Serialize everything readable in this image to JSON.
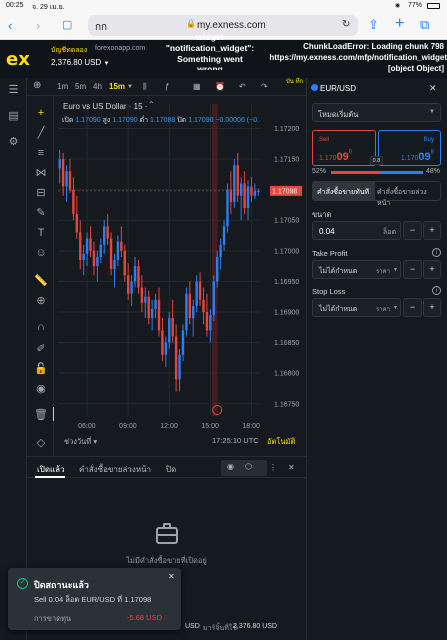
{
  "status": {
    "time": "00:25",
    "date": "จ. 29 เม.ย.",
    "battery": "77%"
  },
  "browser": {
    "aa_label": "กก",
    "url": "my.exness.com"
  },
  "header": {
    "account_tag": "บัญชีทดลอง",
    "site": "forexonapp.com",
    "balance": "2,376.80 USD",
    "error_widget_line1": "widget",
    "error_widget_line2": "\"notification_widget\":",
    "error_widget_line3": "Something went",
    "error_widget_line4": "wrong",
    "error_chunk_line1": "ChunkLoadError: Loading chunk 798",
    "error_chunk_line2": "https://my.exness.com/mfp/notification_widget",
    "error_chunk_line3": "[object Object]"
  },
  "chart_toolbar": {
    "tf1": "1m",
    "tf2": "5m",
    "tf3": "4h",
    "tf4": "15m",
    "extra": "บัน\nทึก"
  },
  "chart": {
    "title": "Euro vs US Dollar · 15 ·",
    "o_label": "เปิด",
    "o_val": "1.17090",
    "h_label": "สูง",
    "h_val": "1.17090",
    "l_label": "ต่ำ",
    "l_val": "1.17088",
    "c_label": "ปิด",
    "c_val": "1.17090",
    "change": "−0.00006 (−0.",
    "current_price": "1.17098",
    "range_label": "ช่วงวันที่",
    "clock": "17:25:10 UTC",
    "auto_label": "อัตโนมัติ"
  },
  "chart_data": {
    "type": "candlestick",
    "ylim": [
      1.1673,
      1.1724
    ],
    "yticks": [
      1.172,
      1.1715,
      1.171,
      1.1705,
      1.17,
      1.1695,
      1.169,
      1.1685,
      1.168,
      1.1675
    ],
    "ytick_labels": [
      "1.17200",
      "1.17150",
      "1.17100",
      "1.17050",
      "1.17000",
      "1.16950",
      "1.16900",
      "1.16850",
      "1.16800",
      "1.16750"
    ],
    "xtick_labels": [
      "06:00",
      "09:00",
      "12:00",
      "15:00",
      "18:00"
    ],
    "xtick_bars": [
      8,
      20,
      32,
      44,
      56
    ],
    "bar_count": 59,
    "candles": [
      [
        1.17135,
        1.17165,
        1.1711,
        1.1715
      ],
      [
        1.1715,
        1.1716,
        1.1709,
        1.17105
      ],
      [
        1.17105,
        1.1714,
        1.1708,
        1.1713
      ],
      [
        1.1713,
        1.1715,
        1.17095,
        1.171
      ],
      [
        1.171,
        1.1712,
        1.1705,
        1.1706
      ],
      [
        1.1706,
        1.1709,
        1.1702,
        1.1703
      ],
      [
        1.1703,
        1.1705,
        1.1697,
        1.16985
      ],
      [
        1.16985,
        1.1701,
        1.1696,
        1.16995
      ],
      [
        1.16995,
        1.1703,
        1.16975,
        1.1702
      ],
      [
        1.1702,
        1.1704,
        1.1699,
        1.17
      ],
      [
        1.17,
        1.17015,
        1.1696,
        1.16975
      ],
      [
        1.16975,
        1.17,
        1.1695,
        1.1699
      ],
      [
        1.1699,
        1.1702,
        1.1698,
        1.1701
      ],
      [
        1.1701,
        1.1705,
        1.16995,
        1.1704
      ],
      [
        1.1704,
        1.1706,
        1.1701,
        1.1702
      ],
      [
        1.1702,
        1.1703,
        1.1696,
        1.1697
      ],
      [
        1.1697,
        1.16995,
        1.1694,
        1.16985
      ],
      [
        1.16985,
        1.17025,
        1.16975,
        1.17015
      ],
      [
        1.17015,
        1.1704,
        1.1699,
        1.17
      ],
      [
        1.17,
        1.1701,
        1.1695,
        1.1696
      ],
      [
        1.1696,
        1.1698,
        1.1692,
        1.1693
      ],
      [
        1.1693,
        1.1696,
        1.1691,
        1.1695
      ],
      [
        1.1695,
        1.1699,
        1.1694,
        1.16975
      ],
      [
        1.16975,
        1.16985,
        1.1693,
        1.1694
      ],
      [
        1.1694,
        1.1696,
        1.169,
        1.16915
      ],
      [
        1.16915,
        1.1694,
        1.1689,
        1.16925
      ],
      [
        1.16925,
        1.16935,
        1.1688,
        1.1689
      ],
      [
        1.1689,
        1.1692,
        1.1687,
        1.16905
      ],
      [
        1.16905,
        1.1693,
        1.1689,
        1.1692
      ],
      [
        1.1692,
        1.1694,
        1.1686,
        1.1687
      ],
      [
        1.1687,
        1.1689,
        1.1682,
        1.1683
      ],
      [
        1.1683,
        1.1686,
        1.1681,
        1.1685
      ],
      [
        1.1685,
        1.169,
        1.1684,
        1.1689
      ],
      [
        1.1689,
        1.1692,
        1.1685,
        1.1686
      ],
      [
        1.1686,
        1.1688,
        1.1677,
        1.1679
      ],
      [
        1.1679,
        1.1684,
        1.1677,
        1.1683
      ],
      [
        1.1683,
        1.1688,
        1.1682,
        1.1687
      ],
      [
        1.1687,
        1.1694,
        1.1686,
        1.1693
      ],
      [
        1.1693,
        1.1695,
        1.1688,
        1.1689
      ],
      [
        1.1689,
        1.1692,
        1.1686,
        1.1691
      ],
      [
        1.1691,
        1.1696,
        1.169,
        1.1695
      ],
      [
        1.1695,
        1.16965,
        1.1691,
        1.1692
      ],
      [
        1.1692,
        1.1694,
        1.1688,
        1.169
      ],
      [
        1.169,
        1.1693,
        1.1686,
        1.1687
      ],
      [
        1.1687,
        1.16905,
        1.1685,
        1.16895
      ],
      [
        1.16895,
        1.1696,
        1.16885,
        1.1695
      ],
      [
        1.1695,
        1.17,
        1.1694,
        1.1699
      ],
      [
        1.1699,
        1.1702,
        1.1697,
        1.1701
      ],
      [
        1.1701,
        1.1705,
        1.17,
        1.1704
      ],
      [
        1.1704,
        1.1711,
        1.1703,
        1.171
      ],
      [
        1.171,
        1.1713,
        1.1706,
        1.1708
      ],
      [
        1.1708,
        1.1715,
        1.1707,
        1.1714
      ],
      [
        1.1714,
        1.1716,
        1.1708,
        1.1709
      ],
      [
        1.1709,
        1.1712,
        1.1705,
        1.1711
      ],
      [
        1.1711,
        1.1713,
        1.1706,
        1.1707
      ],
      [
        1.1707,
        1.17115,
        1.1705,
        1.17105
      ],
      [
        1.17105,
        1.1712,
        1.1708,
        1.1709
      ],
      [
        1.1709,
        1.1711,
        1.17085,
        1.17098
      ],
      [
        1.17098,
        1.17102,
        1.1709,
        1.17098
      ]
    ]
  },
  "bottom": {
    "tab_open": "เปิดแล้ว",
    "tab_pending": "คำสั่งซื้อขายล่วงหน้า",
    "tab_closed": "ปิด",
    "empty_text": "ไม่มีคำสั่งซื้อขายที่เปิดอยู่",
    "foot_currency": "USD",
    "foot_margin_label": "มาร์จิ้นที่ใช้",
    "foot_balance": "2,376.80 USD"
  },
  "toast": {
    "title": "ปิดสถานะแล้ว",
    "detail": "Sell 0.04 ล็อต EUR/USD ที่ 1.17098",
    "profit_label": "การขาดทุน",
    "profit_value": "-5.68 USD"
  },
  "order_panel": {
    "symbol": "EUR/USD",
    "mode": "โหมดเริ่มต้น",
    "sell_label": "Sell",
    "sell_price_main": "1.170",
    "sell_price_big": "09",
    "sell_price_sup": "0",
    "buy_label": "Buy",
    "buy_price_main": "1.170",
    "buy_price_big": "09",
    "buy_price_sup": "8",
    "spread": "0.8",
    "sell_pct": "52%",
    "buy_pct": "48%",
    "sell_pct_value": 52,
    "tab_market": "คำสั่งซื้อขายทันที",
    "tab_pending": "คำสั่งซื้อขายล่วงหน้า",
    "volume_label": "ขนาด",
    "volume_value": "0.04",
    "volume_unit": "ล็อต",
    "tp_label": "Take Profit",
    "tp_value": "ไม่ได้กำหนด",
    "tp_unit": "ราคา",
    "sl_label": "Stop Loss",
    "sl_value": "ไม่ได้กำหนด",
    "sl_unit": "ราคา"
  }
}
